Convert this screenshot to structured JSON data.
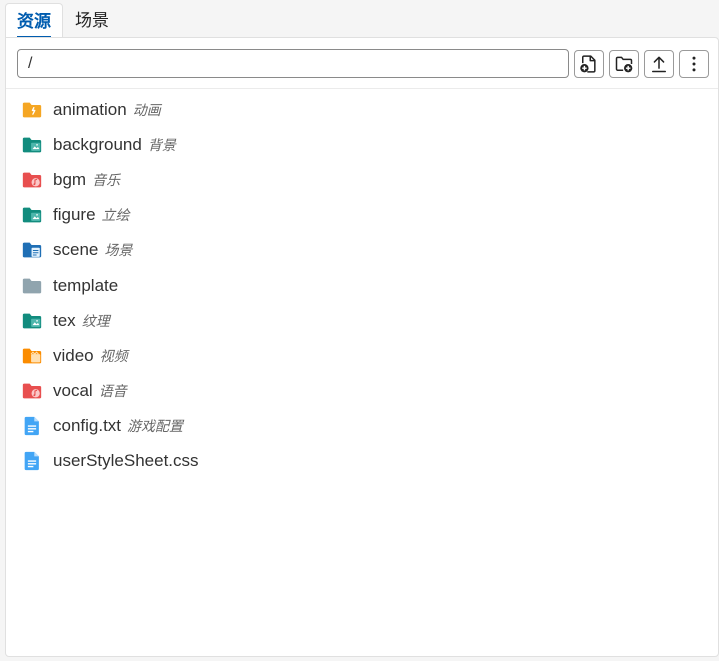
{
  "tabs": [
    {
      "label": "资源"
    },
    {
      "label": "场景"
    }
  ],
  "toolbar": {
    "path_value": "/"
  },
  "colors": {
    "accent": "#005caf",
    "folder_yellow": "#f5a623",
    "folder_teal": "#128c7e",
    "folder_red": "#e84f4f",
    "folder_blue": "#1f6fb5",
    "folder_gray": "#90a4ae",
    "folder_orange": "#fb8c00",
    "file_blue": "#42a5f5"
  },
  "files": [
    {
      "name": "animation",
      "desc": "动画",
      "icon": "folder-animation-icon"
    },
    {
      "name": "background",
      "desc": "背景",
      "icon": "folder-image-icon"
    },
    {
      "name": "bgm",
      "desc": "音乐",
      "icon": "folder-audio-icon"
    },
    {
      "name": "figure",
      "desc": "立绘",
      "icon": "folder-image-icon"
    },
    {
      "name": "scene",
      "desc": "场景",
      "icon": "folder-scene-icon"
    },
    {
      "name": "template",
      "desc": "",
      "icon": "folder-icon"
    },
    {
      "name": "tex",
      "desc": "纹理",
      "icon": "folder-image-icon"
    },
    {
      "name": "video",
      "desc": "视频",
      "icon": "folder-video-icon"
    },
    {
      "name": "vocal",
      "desc": "语音",
      "icon": "folder-audio-icon"
    },
    {
      "name": "config.txt",
      "desc": "游戏配置",
      "icon": "file-text-icon"
    },
    {
      "name": "userStyleSheet.css",
      "desc": "",
      "icon": "file-text-icon"
    }
  ]
}
